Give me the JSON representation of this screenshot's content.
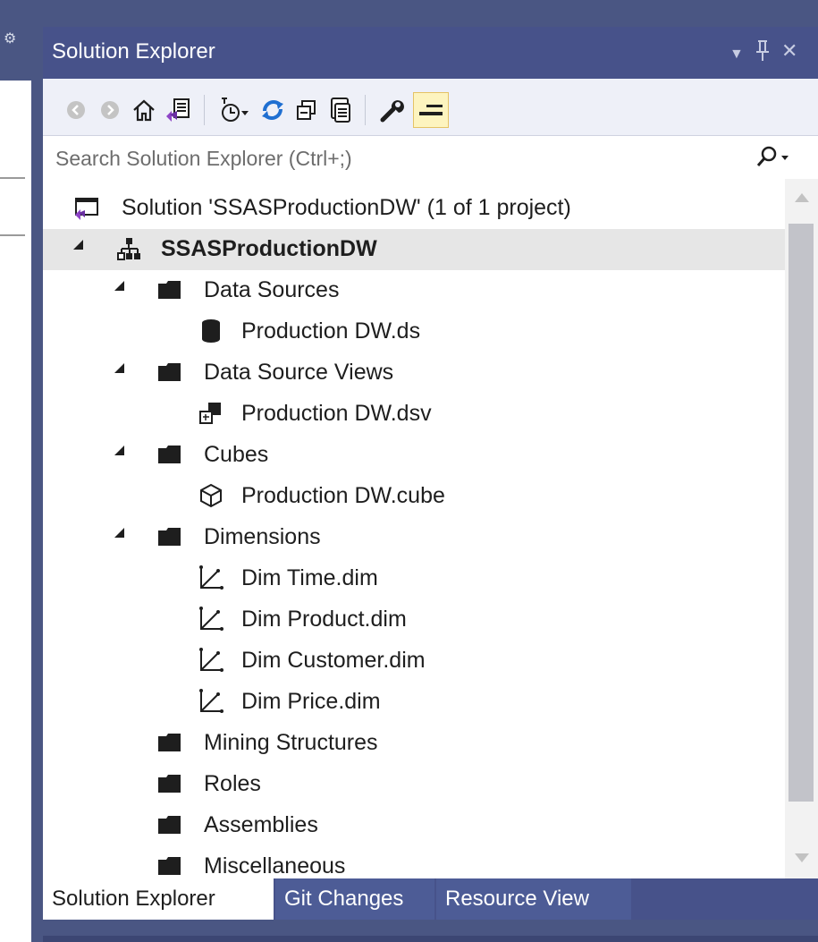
{
  "window": {
    "title": "Solution Explorer"
  },
  "search": {
    "placeholder": "Search Solution Explorer (Ctrl+;)"
  },
  "tree": {
    "solution": "Solution 'SSASProductionDW' (1 of 1 project)",
    "project": "SSASProductionDW",
    "data_sources": "Data Sources",
    "data_source_item": "Production DW.ds",
    "data_source_views": "Data Source Views",
    "data_source_view_item": "Production DW.dsv",
    "cubes": "Cubes",
    "cube_item": "Production DW.cube",
    "dimensions": "Dimensions",
    "dimension_items": [
      "Dim Time.dim",
      "Dim Product.dim",
      "Dim Customer.dim",
      "Dim Price.dim"
    ],
    "mining_structures": "Mining Structures",
    "roles": "Roles",
    "assemblies": "Assemblies",
    "miscellaneous": "Miscellaneous"
  },
  "tabs": [
    "Solution Explorer",
    "Git Changes",
    "Resource View"
  ],
  "colors": {
    "title_bar": "#47528a",
    "toolbar": "#eef0f8",
    "selected_row": "#e6e6e6",
    "active_toggle": "#fdf4bf"
  },
  "icons": {
    "title_bar": [
      "dropdown-arrow-icon",
      "pin-icon",
      "close-icon"
    ],
    "toolbar": [
      "back-icon",
      "forward-icon",
      "home-icon",
      "switch-views-icon",
      "pending-changes-filter-icon",
      "sync-icon",
      "collapse-all-icon",
      "show-all-files-icon",
      "properties-icon",
      "preview-selected-items-icon"
    ]
  }
}
